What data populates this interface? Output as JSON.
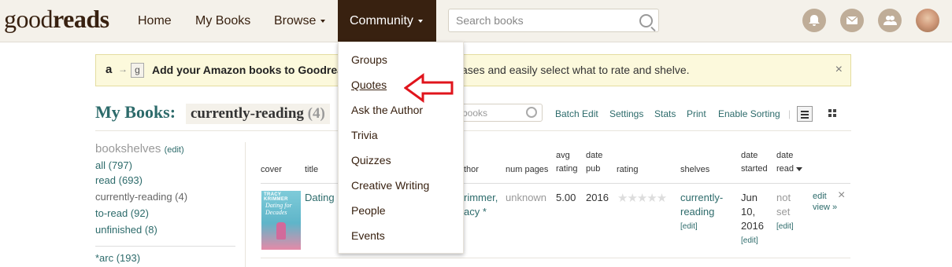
{
  "header": {
    "logo_light": "good",
    "logo_bold": "reads",
    "nav": {
      "home": "Home",
      "my_books": "My Books",
      "browse": "Browse",
      "community": "Community"
    },
    "search_placeholder": "Search books",
    "icons": [
      "notifications-icon",
      "messages-icon",
      "friends-icon",
      "profile-avatar"
    ]
  },
  "community_menu": {
    "items": [
      "Groups",
      "Quotes",
      "Ask the Author",
      "Trivia",
      "Quizzes",
      "Creative Writing",
      "People",
      "Events"
    ],
    "highlighted": "Quotes"
  },
  "banner": {
    "amazon_glyph": "a",
    "goodreads_glyph": "g",
    "text_bold": "Add your Amazon books to Goodreads",
    "text_rest": "ases and easily select what to rate and shelve.",
    "close": "×"
  },
  "mybooks": {
    "title": "My Books:",
    "shelf": "currently-reading",
    "shelf_count": "(4)",
    "search_placeholder": "books",
    "tools": [
      "Batch Edit",
      "Settings",
      "Stats",
      "Print",
      "Enable Sorting"
    ],
    "separator": "|"
  },
  "sidebar": {
    "title": "bookshelves",
    "edit": "(edit)",
    "items": [
      "all (797)",
      "read (693)",
      "currently-reading (4)",
      "to-read (92)",
      "unfinished (8)",
      "*arc (193)"
    ]
  },
  "table": {
    "headers": {
      "cover": "cover",
      "title": "title",
      "author": "thor",
      "num_pages": "num pages",
      "avg": "avg",
      "avg2": "rating",
      "date_pub": "date",
      "date_pub2": "pub",
      "rating": "rating",
      "shelves": "shelves",
      "started": "date",
      "started2": "started",
      "read": "date",
      "read2": "read"
    },
    "row": {
      "cover_author": "TRACY KRIMMER",
      "cover_title": "Dating for Decades",
      "title": "Dating",
      "author_line1": "rimmer,",
      "author_line2": "acy *",
      "num_pages": "unknown",
      "avg_rating": "5.00",
      "date_pub": "2016",
      "stars": "★★★★★",
      "shelf_line1": "currently-",
      "shelf_line2": "reading",
      "edit": "[edit]",
      "started_line1": "Jun",
      "started_line2": "10,",
      "started_line3": "2016",
      "read_line1": "not",
      "read_line2": "set",
      "action_edit": "edit",
      "action_view": "view »",
      "remove": "×"
    }
  }
}
